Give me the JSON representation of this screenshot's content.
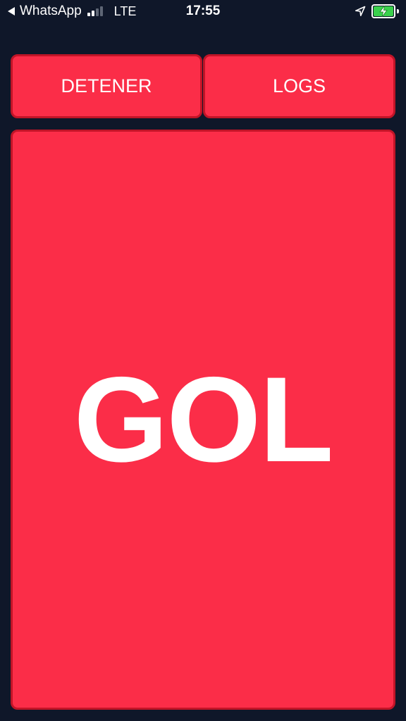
{
  "status_bar": {
    "back_app": "WhatsApp",
    "signal_bars_filled": 2,
    "signal_bars_total": 4,
    "network": "LTE",
    "time": "17:55",
    "location_icon": "location-arrow-icon",
    "battery_level": 1.0,
    "battery_charging": true,
    "battery_color": "#3ad14c"
  },
  "controls": {
    "stop_label": "DETENER",
    "logs_label": "LOGS"
  },
  "main": {
    "goal_label": "GOL"
  },
  "colors": {
    "background": "#0f1729",
    "button": "#fb2d48",
    "button_border": "#c11427"
  }
}
